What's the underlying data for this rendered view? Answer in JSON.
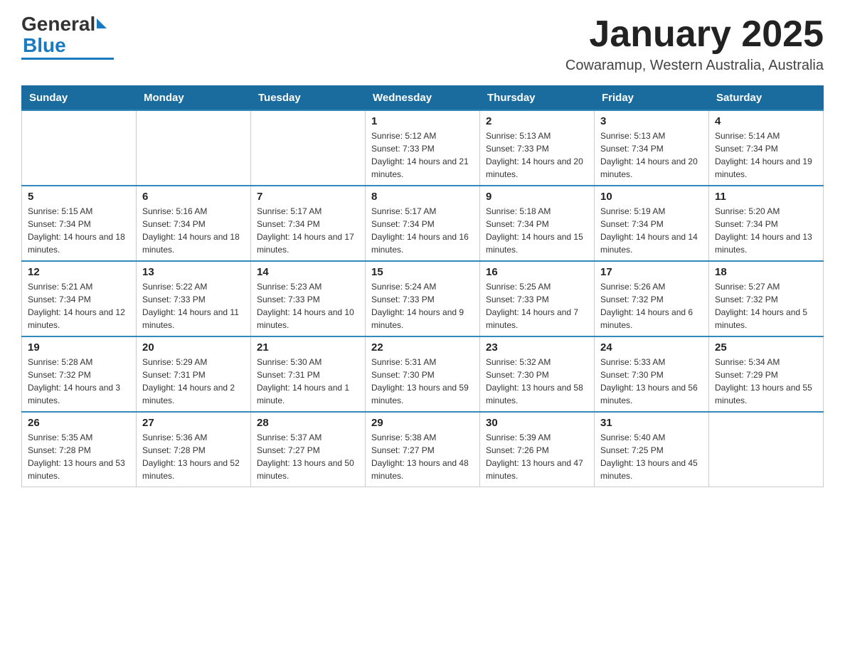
{
  "header": {
    "logo_general": "General",
    "logo_blue": "Blue",
    "main_title": "January 2025",
    "subtitle": "Cowaramup, Western Australia, Australia"
  },
  "calendar": {
    "days_of_week": [
      "Sunday",
      "Monday",
      "Tuesday",
      "Wednesday",
      "Thursday",
      "Friday",
      "Saturday"
    ],
    "weeks": [
      [
        {
          "day": "",
          "info": ""
        },
        {
          "day": "",
          "info": ""
        },
        {
          "day": "",
          "info": ""
        },
        {
          "day": "1",
          "info": "Sunrise: 5:12 AM\nSunset: 7:33 PM\nDaylight: 14 hours and 21 minutes."
        },
        {
          "day": "2",
          "info": "Sunrise: 5:13 AM\nSunset: 7:33 PM\nDaylight: 14 hours and 20 minutes."
        },
        {
          "day": "3",
          "info": "Sunrise: 5:13 AM\nSunset: 7:34 PM\nDaylight: 14 hours and 20 minutes."
        },
        {
          "day": "4",
          "info": "Sunrise: 5:14 AM\nSunset: 7:34 PM\nDaylight: 14 hours and 19 minutes."
        }
      ],
      [
        {
          "day": "5",
          "info": "Sunrise: 5:15 AM\nSunset: 7:34 PM\nDaylight: 14 hours and 18 minutes."
        },
        {
          "day": "6",
          "info": "Sunrise: 5:16 AM\nSunset: 7:34 PM\nDaylight: 14 hours and 18 minutes."
        },
        {
          "day": "7",
          "info": "Sunrise: 5:17 AM\nSunset: 7:34 PM\nDaylight: 14 hours and 17 minutes."
        },
        {
          "day": "8",
          "info": "Sunrise: 5:17 AM\nSunset: 7:34 PM\nDaylight: 14 hours and 16 minutes."
        },
        {
          "day": "9",
          "info": "Sunrise: 5:18 AM\nSunset: 7:34 PM\nDaylight: 14 hours and 15 minutes."
        },
        {
          "day": "10",
          "info": "Sunrise: 5:19 AM\nSunset: 7:34 PM\nDaylight: 14 hours and 14 minutes."
        },
        {
          "day": "11",
          "info": "Sunrise: 5:20 AM\nSunset: 7:34 PM\nDaylight: 14 hours and 13 minutes."
        }
      ],
      [
        {
          "day": "12",
          "info": "Sunrise: 5:21 AM\nSunset: 7:34 PM\nDaylight: 14 hours and 12 minutes."
        },
        {
          "day": "13",
          "info": "Sunrise: 5:22 AM\nSunset: 7:33 PM\nDaylight: 14 hours and 11 minutes."
        },
        {
          "day": "14",
          "info": "Sunrise: 5:23 AM\nSunset: 7:33 PM\nDaylight: 14 hours and 10 minutes."
        },
        {
          "day": "15",
          "info": "Sunrise: 5:24 AM\nSunset: 7:33 PM\nDaylight: 14 hours and 9 minutes."
        },
        {
          "day": "16",
          "info": "Sunrise: 5:25 AM\nSunset: 7:33 PM\nDaylight: 14 hours and 7 minutes."
        },
        {
          "day": "17",
          "info": "Sunrise: 5:26 AM\nSunset: 7:32 PM\nDaylight: 14 hours and 6 minutes."
        },
        {
          "day": "18",
          "info": "Sunrise: 5:27 AM\nSunset: 7:32 PM\nDaylight: 14 hours and 5 minutes."
        }
      ],
      [
        {
          "day": "19",
          "info": "Sunrise: 5:28 AM\nSunset: 7:32 PM\nDaylight: 14 hours and 3 minutes."
        },
        {
          "day": "20",
          "info": "Sunrise: 5:29 AM\nSunset: 7:31 PM\nDaylight: 14 hours and 2 minutes."
        },
        {
          "day": "21",
          "info": "Sunrise: 5:30 AM\nSunset: 7:31 PM\nDaylight: 14 hours and 1 minute."
        },
        {
          "day": "22",
          "info": "Sunrise: 5:31 AM\nSunset: 7:30 PM\nDaylight: 13 hours and 59 minutes."
        },
        {
          "day": "23",
          "info": "Sunrise: 5:32 AM\nSunset: 7:30 PM\nDaylight: 13 hours and 58 minutes."
        },
        {
          "day": "24",
          "info": "Sunrise: 5:33 AM\nSunset: 7:30 PM\nDaylight: 13 hours and 56 minutes."
        },
        {
          "day": "25",
          "info": "Sunrise: 5:34 AM\nSunset: 7:29 PM\nDaylight: 13 hours and 55 minutes."
        }
      ],
      [
        {
          "day": "26",
          "info": "Sunrise: 5:35 AM\nSunset: 7:28 PM\nDaylight: 13 hours and 53 minutes."
        },
        {
          "day": "27",
          "info": "Sunrise: 5:36 AM\nSunset: 7:28 PM\nDaylight: 13 hours and 52 minutes."
        },
        {
          "day": "28",
          "info": "Sunrise: 5:37 AM\nSunset: 7:27 PM\nDaylight: 13 hours and 50 minutes."
        },
        {
          "day": "29",
          "info": "Sunrise: 5:38 AM\nSunset: 7:27 PM\nDaylight: 13 hours and 48 minutes."
        },
        {
          "day": "30",
          "info": "Sunrise: 5:39 AM\nSunset: 7:26 PM\nDaylight: 13 hours and 47 minutes."
        },
        {
          "day": "31",
          "info": "Sunrise: 5:40 AM\nSunset: 7:25 PM\nDaylight: 13 hours and 45 minutes."
        },
        {
          "day": "",
          "info": ""
        }
      ]
    ]
  }
}
